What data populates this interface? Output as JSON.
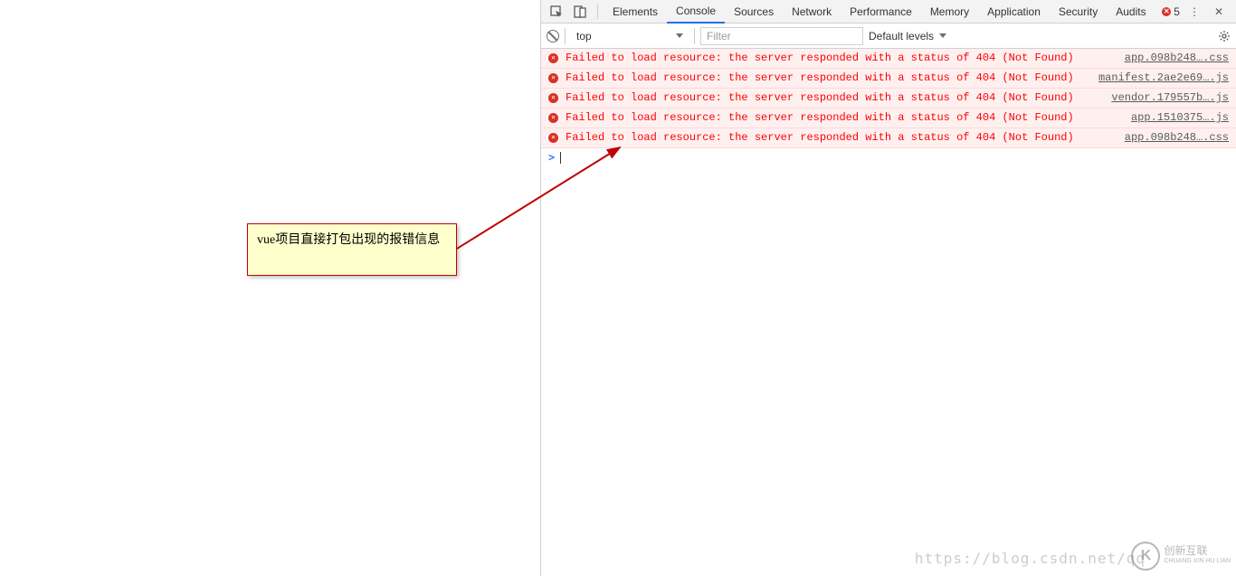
{
  "tabs": {
    "items": [
      "Elements",
      "Console",
      "Sources",
      "Network",
      "Performance",
      "Memory",
      "Application",
      "Security",
      "Audits"
    ],
    "active_index": 1,
    "error_count": "5"
  },
  "toolbar": {
    "context": "top",
    "filter_placeholder": "Filter",
    "levels": "Default levels"
  },
  "console": {
    "errors": [
      {
        "message": "Failed to load resource: the server responded with a status of 404 (Not Found)",
        "source": "app.098b248….css"
      },
      {
        "message": "Failed to load resource: the server responded with a status of 404 (Not Found)",
        "source": "manifest.2ae2e69….js"
      },
      {
        "message": "Failed to load resource: the server responded with a status of 404 (Not Found)",
        "source": "vendor.179557b….js"
      },
      {
        "message": "Failed to load resource: the server responded with a status of 404 (Not Found)",
        "source": "app.1510375….js"
      },
      {
        "message": "Failed to load resource: the server responded with a status of 404 (Not Found)",
        "source": "app.098b248….css"
      }
    ],
    "prompt": ">"
  },
  "annotation": {
    "text": "vue项目直接打包出现的报错信息"
  },
  "watermark": {
    "url": "https://blog.csdn.net/qq",
    "logo_text": "创新互联",
    "logo_sub": "CHUANG XIN HU LIAN"
  }
}
